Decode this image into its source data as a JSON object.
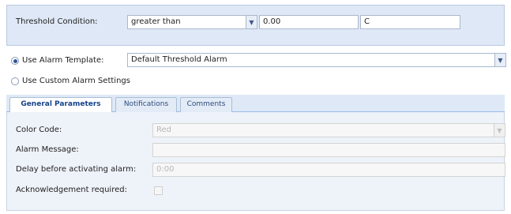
{
  "threshold": {
    "label": "Threshold Condition:",
    "operator": "greater than",
    "value": "0.00",
    "unit": "C"
  },
  "alarm_template": {
    "label": "Use Alarm Template:",
    "selected": true,
    "value": "Default Threshold Alarm"
  },
  "custom_settings": {
    "label": "Use Custom Alarm Settings",
    "selected": false
  },
  "tabs": [
    {
      "label": "General Parameters",
      "active": true
    },
    {
      "label": "Notifications",
      "active": false
    },
    {
      "label": "Comments",
      "active": false
    }
  ],
  "general": {
    "color_code_label": "Color Code:",
    "color_code_value": "Red",
    "alarm_message_label": "Alarm Message:",
    "alarm_message_value": "",
    "delay_label": "Delay before activating alarm:",
    "delay_value": "0:00",
    "ack_label": "Acknowledgement required:",
    "ack_checked": false
  },
  "icons": {
    "dropdown": "chevron-down-icon"
  }
}
